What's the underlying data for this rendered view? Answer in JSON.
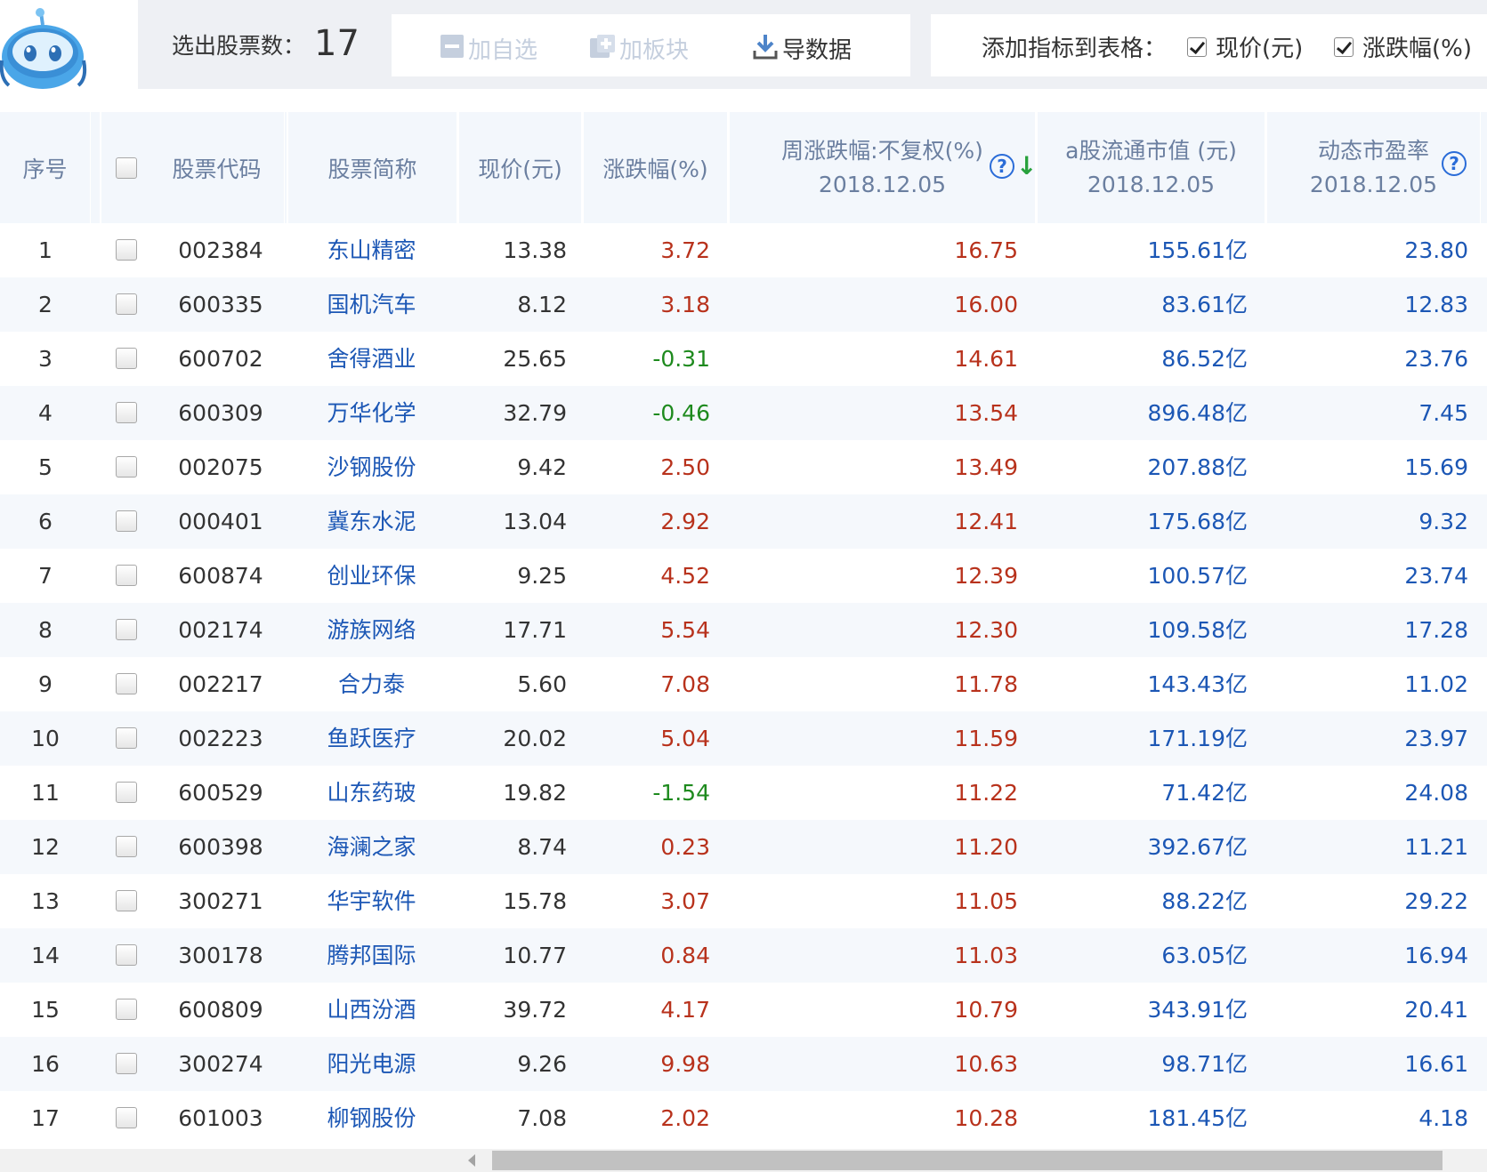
{
  "toolbar": {
    "count_label": "选出股票数：",
    "count_value": "17",
    "add_watchlist": "加自选",
    "add_sector": "加板块",
    "export_data": "导数据",
    "indicator_label": "添加指标到表格：",
    "indicator_price": "现价(元)",
    "indicator_change": "涨跌幅(%)"
  },
  "table": {
    "headers": {
      "index": "序号",
      "code": "股票代码",
      "name": "股票简称",
      "price": "现价(元)",
      "change": "涨跌幅(%)",
      "weekly": "周涨跌幅:不复权(%)",
      "weekly_date": "2018.12.05",
      "mktval": "a股流通市值 (元)",
      "mktval_date": "2018.12.05",
      "pe": "动态市盈率",
      "pe_date": "2018.12.05"
    },
    "rows": [
      {
        "idx": "1",
        "code": "002384",
        "name": "东山精密",
        "price": "13.38",
        "change": "3.72",
        "weekly": "16.75",
        "mktval": "155.61亿",
        "pe": "23.80"
      },
      {
        "idx": "2",
        "code": "600335",
        "name": "国机汽车",
        "price": "8.12",
        "change": "3.18",
        "weekly": "16.00",
        "mktval": "83.61亿",
        "pe": "12.83"
      },
      {
        "idx": "3",
        "code": "600702",
        "name": "舍得酒业",
        "price": "25.65",
        "change": "-0.31",
        "weekly": "14.61",
        "mktval": "86.52亿",
        "pe": "23.76"
      },
      {
        "idx": "4",
        "code": "600309",
        "name": "万华化学",
        "price": "32.79",
        "change": "-0.46",
        "weekly": "13.54",
        "mktval": "896.48亿",
        "pe": "7.45"
      },
      {
        "idx": "5",
        "code": "002075",
        "name": "沙钢股份",
        "price": "9.42",
        "change": "2.50",
        "weekly": "13.49",
        "mktval": "207.88亿",
        "pe": "15.69"
      },
      {
        "idx": "6",
        "code": "000401",
        "name": "冀东水泥",
        "price": "13.04",
        "change": "2.92",
        "weekly": "12.41",
        "mktval": "175.68亿",
        "pe": "9.32"
      },
      {
        "idx": "7",
        "code": "600874",
        "name": "创业环保",
        "price": "9.25",
        "change": "4.52",
        "weekly": "12.39",
        "mktval": "100.57亿",
        "pe": "23.74"
      },
      {
        "idx": "8",
        "code": "002174",
        "name": "游族网络",
        "price": "17.71",
        "change": "5.54",
        "weekly": "12.30",
        "mktval": "109.58亿",
        "pe": "17.28"
      },
      {
        "idx": "9",
        "code": "002217",
        "name": "合力泰",
        "price": "5.60",
        "change": "7.08",
        "weekly": "11.78",
        "mktval": "143.43亿",
        "pe": "11.02"
      },
      {
        "idx": "10",
        "code": "002223",
        "name": "鱼跃医疗",
        "price": "20.02",
        "change": "5.04",
        "weekly": "11.59",
        "mktval": "171.19亿",
        "pe": "23.97"
      },
      {
        "idx": "11",
        "code": "600529",
        "name": "山东药玻",
        "price": "19.82",
        "change": "-1.54",
        "weekly": "11.22",
        "mktval": "71.42亿",
        "pe": "24.08"
      },
      {
        "idx": "12",
        "code": "600398",
        "name": "海澜之家",
        "price": "8.74",
        "change": "0.23",
        "weekly": "11.20",
        "mktval": "392.67亿",
        "pe": "11.21"
      },
      {
        "idx": "13",
        "code": "300271",
        "name": "华宇软件",
        "price": "15.78",
        "change": "3.07",
        "weekly": "11.05",
        "mktval": "88.22亿",
        "pe": "29.22"
      },
      {
        "idx": "14",
        "code": "300178",
        "name": "腾邦国际",
        "price": "10.77",
        "change": "0.84",
        "weekly": "11.03",
        "mktval": "63.05亿",
        "pe": "16.94"
      },
      {
        "idx": "15",
        "code": "600809",
        "name": "山西汾酒",
        "price": "39.72",
        "change": "4.17",
        "weekly": "10.79",
        "mktval": "343.91亿",
        "pe": "20.41"
      },
      {
        "idx": "16",
        "code": "300274",
        "name": "阳光电源",
        "price": "9.26",
        "change": "9.98",
        "weekly": "10.63",
        "mktval": "98.71亿",
        "pe": "16.61"
      },
      {
        "idx": "17",
        "code": "601003",
        "name": "柳钢股份",
        "price": "7.08",
        "change": "2.02",
        "weekly": "10.28",
        "mktval": "181.45亿",
        "pe": "4.18"
      }
    ]
  },
  "colors": {
    "up": "#b8321c",
    "down": "#1e8a1e",
    "link": "#1c57b5",
    "header_text": "#6b7fa0"
  }
}
